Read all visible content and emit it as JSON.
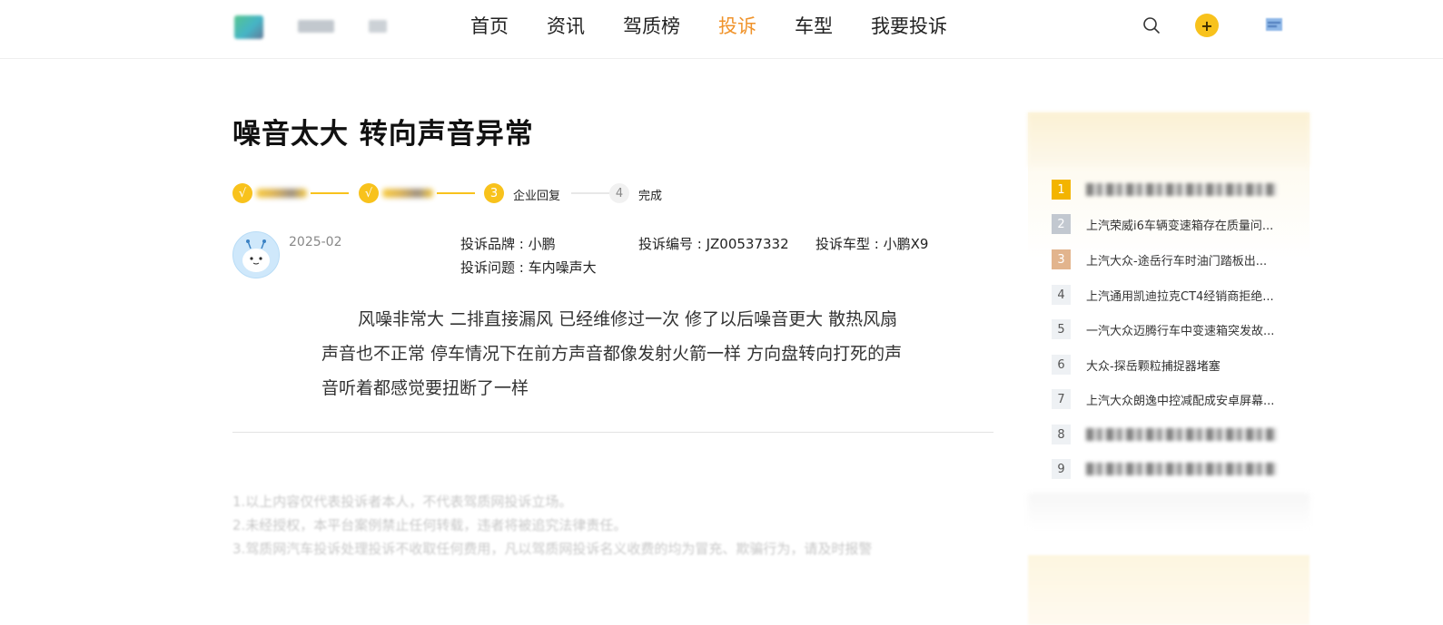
{
  "header": {
    "logo_name": "logo",
    "nav": [
      {
        "label": "首页",
        "active": false
      },
      {
        "label": "资讯",
        "active": false
      },
      {
        "label": "驾质榜",
        "active": false
      },
      {
        "label": "投诉",
        "active": true
      },
      {
        "label": "车型",
        "active": false
      },
      {
        "label": "我要投诉",
        "active": false
      }
    ],
    "icons": {
      "search": "search-icon",
      "plus": "plus-icon",
      "user": "user-icon"
    },
    "accent_color": "#f0932b"
  },
  "complaint": {
    "title": "噪音太大 转向声音异常",
    "steps": [
      {
        "number": "√",
        "label": "",
        "state": "done"
      },
      {
        "number": "√",
        "label": "",
        "state": "done"
      },
      {
        "number": "3",
        "label": "企业回复",
        "state": "current"
      },
      {
        "number": "4",
        "label": "完成",
        "state": "todo"
      }
    ],
    "date": "2025-02",
    "brand": "投诉品牌 : 小鹏",
    "number": "投诉编号 : JZ00537332",
    "model": "投诉车型 : 小鹏X9",
    "issue": "投诉问题 : 车内噪声大",
    "body": "风噪非常大 二排直接漏风 已经维修过一次 修了以后噪音更大 散热风扇声音也不正常 停车情况下在前方声音都像发射火箭一样 方向盘转向打死的声音听着都感觉要扭断了一样"
  },
  "disclaimer": [
    "1.以上内容仅代表投诉者本人，不代表驾质网投诉立场。",
    "2.未经授权，本平台案例禁止任何转载，违者将被追究法律责任。",
    "3.驾质网汽车投诉处理投诉不收取任何费用，凡以驾质网投诉名义收费的均为冒充、欺骗行为，请及时报警"
  ],
  "sidebar": {
    "ranking": [
      {
        "rank": "1",
        "title": "",
        "blurred": true,
        "style": "gold"
      },
      {
        "rank": "2",
        "title": "上汽荣威i6车辆变速箱存在质量问...",
        "blurred": false,
        "style": "silver"
      },
      {
        "rank": "3",
        "title": "上汽大众-途岳行车时油门踏板出...",
        "blurred": false,
        "style": "bronze"
      },
      {
        "rank": "4",
        "title": "上汽通用凯迪拉克CT4经销商拒绝...",
        "blurred": false,
        "style": "plain"
      },
      {
        "rank": "5",
        "title": "一汽大众迈腾行车中变速箱突发故...",
        "blurred": false,
        "style": "plain"
      },
      {
        "rank": "6",
        "title": "大众-探岳颗粒捕捉器堵塞",
        "blurred": false,
        "style": "plain"
      },
      {
        "rank": "7",
        "title": "上汽大众朗逸中控减配成安卓屏幕...",
        "blurred": false,
        "style": "plain"
      },
      {
        "rank": "8",
        "title": "",
        "blurred": true,
        "style": "plain"
      },
      {
        "rank": "9",
        "title": "",
        "blurred": true,
        "style": "plain"
      }
    ]
  }
}
